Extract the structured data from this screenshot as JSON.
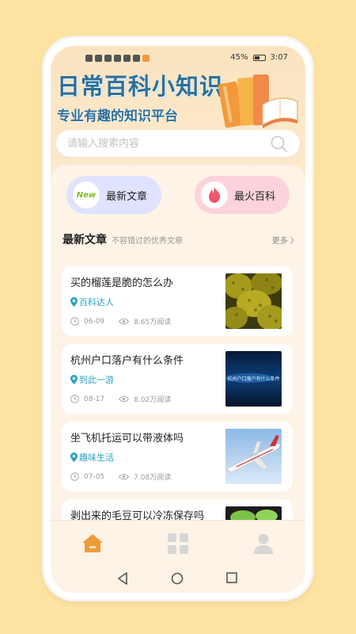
{
  "status": {
    "battery": "45%",
    "time": "3:07"
  },
  "header": {
    "title": "日常百科小知识",
    "subtitle": "专业有趣的知识平台"
  },
  "search": {
    "placeholder": "请输入搜索内容",
    "icon": "search-icon"
  },
  "categories": [
    {
      "label": "最新文章",
      "badge": "New",
      "color": "#dfe3ff"
    },
    {
      "label": "最火百科",
      "icon": "flame-icon",
      "color": "#fcd3dc"
    }
  ],
  "section": {
    "title": "最新文章",
    "subtitle": "不容错过的优秀文章",
    "more": "更多 〉"
  },
  "articles": [
    {
      "title": "买的榴莲是脆的怎么办",
      "category": "百科达人",
      "date": "06-09",
      "views": "8.65万阅读",
      "thumb": "durian"
    },
    {
      "title": "杭州户口落户有什么条件",
      "category": "到此一游",
      "date": "08-17",
      "views": "8.02万阅读",
      "thumb": "hangzhou"
    },
    {
      "title": "坐飞机托运可以带液体吗",
      "category": "趣味生活",
      "date": "07-05",
      "views": "7.08万阅读",
      "thumb": "airplane"
    },
    {
      "title": "剥出来的毛豆可以冷冻保存吗",
      "category": "",
      "date": "",
      "views": "",
      "thumb": "edamame"
    }
  ],
  "thumb_text": {
    "hangzhou": "杭州户口落户有什么条件"
  },
  "tabs": [
    {
      "name": "home",
      "active": true,
      "color": "#f19a3a"
    },
    {
      "name": "grid",
      "active": false,
      "color": "#d6d6d6"
    },
    {
      "name": "user",
      "active": false,
      "color": "#d6d6d6"
    }
  ],
  "accent": "#2d6f9a"
}
